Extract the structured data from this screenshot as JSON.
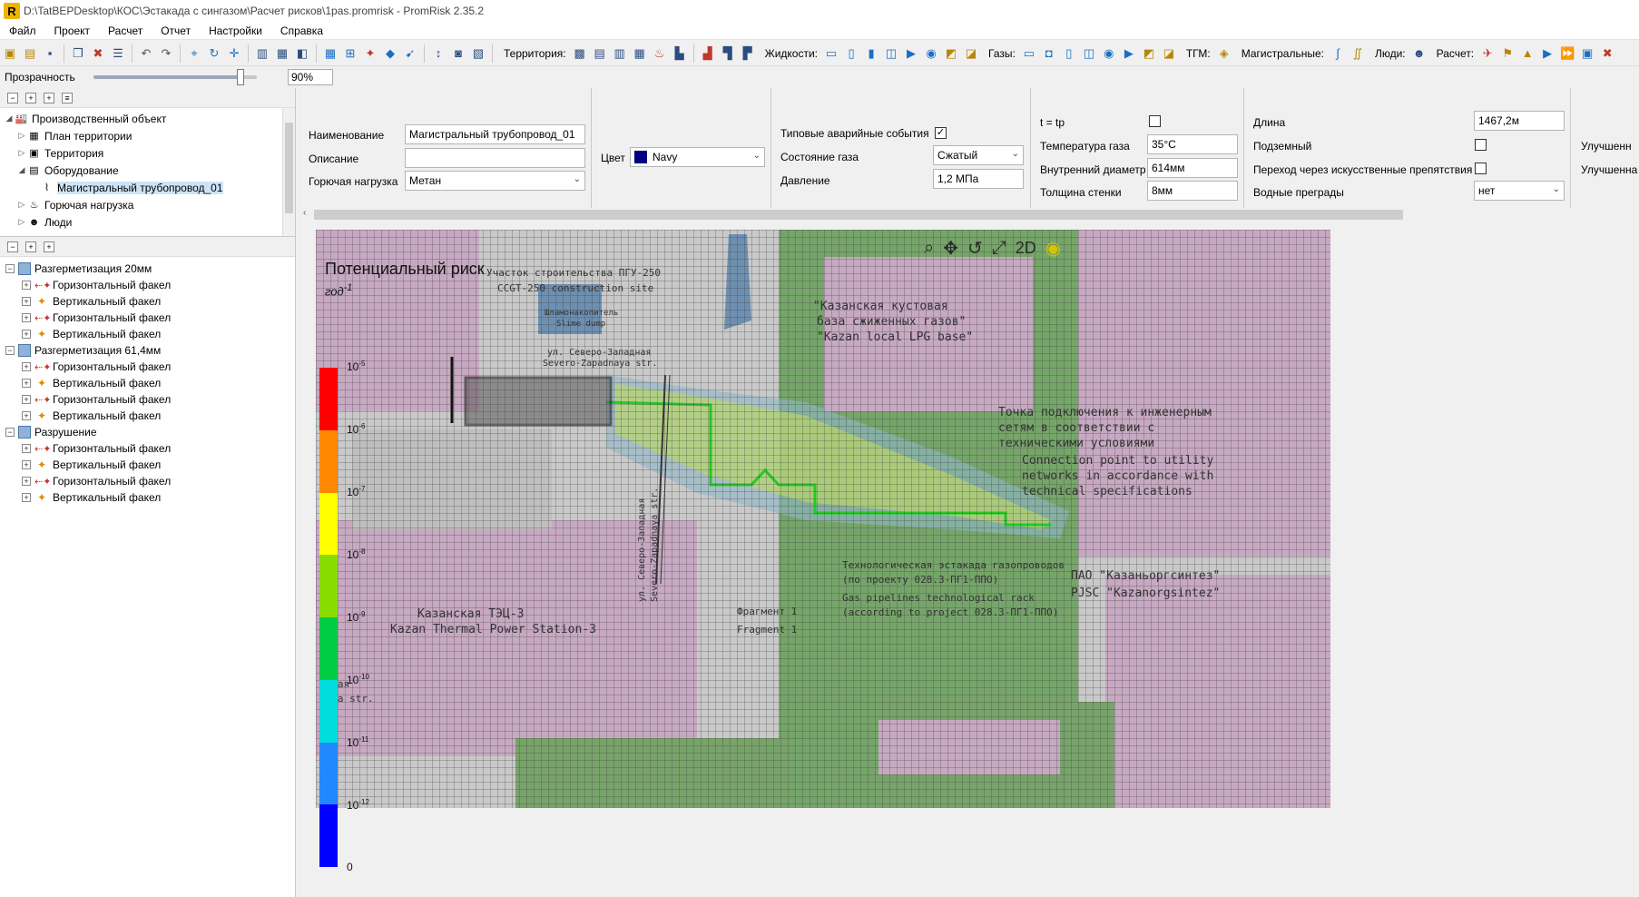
{
  "titlebar": {
    "text": "D:\\TatBEPDesktop\\КОС\\Эстакада с сингазом\\Расчет рисков\\1pas.promrisk - PromRisk 2.35.2",
    "icon": "R"
  },
  "menu": [
    "Файл",
    "Проект",
    "Расчет",
    "Отчет",
    "Настройки",
    "Справка"
  ],
  "toolbar": {
    "territory_label": "Территория:",
    "liquids_label": "Жидкости:",
    "gases_label": "Газы:",
    "tgm_label": "ТГМ:",
    "mains_label": "Магистральные:",
    "people_label": "Люди:",
    "calc_label": "Расчет:"
  },
  "transparency": {
    "label": "Прозрачность",
    "value": "90%",
    "level": 0.9
  },
  "tree": [
    {
      "label": "Производственный объект",
      "icon": "factory-icon",
      "level": 0,
      "expanded": true
    },
    {
      "label": "План территории",
      "icon": "plan-icon",
      "level": 1
    },
    {
      "label": "Территория",
      "icon": "territory-icon",
      "level": 1
    },
    {
      "label": "Оборудование",
      "icon": "equipment-icon",
      "level": 1,
      "expanded": true
    },
    {
      "label": "Магистральный трубопровод_01",
      "icon": "pipeline-icon",
      "level": 2,
      "selected": true
    },
    {
      "label": "Горючая нагрузка",
      "icon": "fuel-load-icon",
      "level": 1
    },
    {
      "label": "Люди",
      "icon": "people-icon",
      "level": 1
    }
  ],
  "scenarios": [
    {
      "label": "Разгерметизация 20мм",
      "items": [
        "Горизонтальный факел",
        "Вертикальный факел",
        "Горизонтальный факел",
        "Вертикальный факел"
      ]
    },
    {
      "label": "Разгерметизация 61,4мм",
      "items": [
        "Горизонтальный факел",
        "Вертикальный факел",
        "Горизонтальный факел",
        "Вертикальный факел"
      ]
    },
    {
      "label": "Разрушение",
      "items": [
        "Горизонтальный факел",
        "Вертикальный факел",
        "Горизонтальный факел",
        "Вертикальный факел"
      ]
    }
  ],
  "props": {
    "name_label": "Наименование",
    "name_value": "Магистральный трубопровод_01",
    "desc_label": "Описание",
    "desc_value": "",
    "fuel_label": "Горючая нагрузка",
    "fuel_value": "Метан",
    "color_label": "Цвет",
    "color_value": "Navy",
    "color_hex": "#000080",
    "typical_label": "Типовые аварийные события",
    "typical_checked": "✓",
    "gas_state_label": "Состояние газа",
    "gas_state_value": "Сжатый",
    "pressure_label": "Давление",
    "pressure_value": "1,2 МПа",
    "ttp_label": "t = tp",
    "temp_label": "Температура газа",
    "temp_value": "35°C",
    "diam_label": "Внутренний диаметр",
    "diam_value": "614мм",
    "wall_label": "Толщина стенки",
    "wall_value": "8мм",
    "length_label": "Длина",
    "length_value": "1467,2м",
    "underground_label": "Подземный",
    "crossing_label": "Переход через искусственные препятствия",
    "water_label": "Водные преграды",
    "water_value": "нет",
    "improved1": "Улучшенн",
    "improved2": "Улучшенна"
  },
  "map": {
    "title": "Потенциальный риск",
    "unit": "год",
    "unit_exp": "-1",
    "tools": [
      "search-icon",
      "pan-icon",
      "rotate-icon",
      "fit-icon",
      "2D",
      "risk-layer-icon"
    ],
    "mode": "2D",
    "legend_colors": [
      "#ff0000",
      "#ff8800",
      "#ffff00",
      "#88dd00",
      "#00cc44",
      "#00dddd",
      "#2288ff",
      "#0000ff"
    ],
    "legend_ticks": [
      {
        "base": "10",
        "exp": "-5"
      },
      {
        "base": "10",
        "exp": "-6"
      },
      {
        "base": "10",
        "exp": "-7"
      },
      {
        "base": "10",
        "exp": "-8"
      },
      {
        "base": "10",
        "exp": "-9"
      },
      {
        "base": "10",
        "exp": "-10"
      },
      {
        "base": "10",
        "exp": "-11"
      },
      {
        "base": "10",
        "exp": "-12"
      },
      {
        "base": "0",
        "exp": ""
      }
    ],
    "labels": {
      "ccgt_ru": "Участок строительства ПГУ-250",
      "ccgt_en": "CCGT-250 construction site",
      "lpg_ru1": "\"Казанская кустовая",
      "lpg_ru2": "база сжиженных газов\"",
      "lpg_en": "\"Kazan local LPG base\"",
      "slime_ru": "Шламонакопитель",
      "slime_en": "Slime dump",
      "street1_ru": "ул. Северо-Западная",
      "street1_en": "Severo-Zapadnaya str.",
      "conn_ru1": "Точка подключения к инженерным",
      "conn_ru2": "сетям в соответствии с",
      "conn_ru3": "техническими условиями",
      "conn_en1": "Connection point to utility",
      "conn_en2": "networks in accordance with",
      "conn_en3": "technical specifications",
      "rack_ru1": "Технологическая эстакада газопроводов",
      "rack_ru2": "(по проекту 028.3-ПГ1-ППО)",
      "rack_en1": "Gas pipelines technological rack",
      "rack_en2": "(according to project 028.3-ПГ1-ППО)",
      "frag_ru": "Фрагмент 1",
      "frag_en": "Fragment 1",
      "pjsc_ru": "ПАО \"Казаньоргсинтез\"",
      "pjsc_en": "PJSC \"Kazanorgsintez\"",
      "tec_ru": "Казанская ТЭЦ-3",
      "tec_en": "Kazan Thermal Power Station-3",
      "street2_ru": "ул. Северо-Западная",
      "street2_en": "Severo-Zapadnaya str.",
      "street3_ru": "Эская",
      "street3_en": "naya str."
    }
  }
}
